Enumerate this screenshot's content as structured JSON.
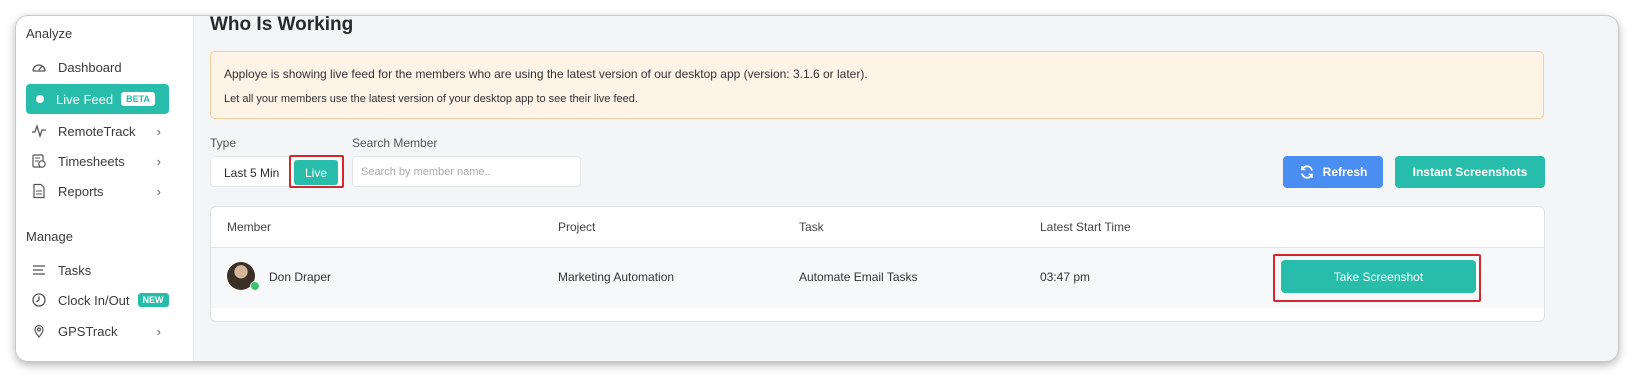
{
  "sidebar": {
    "sections": [
      {
        "label": "Analyze"
      },
      {
        "label": "Manage"
      }
    ],
    "items": [
      {
        "label": "Dashboard",
        "icon": "gauge-icon"
      },
      {
        "label": "Live Feed",
        "icon": "dot-icon",
        "badge": "BETA",
        "active": true
      },
      {
        "label": "RemoteTrack",
        "icon": "pulse-icon"
      },
      {
        "label": "Timesheets",
        "icon": "timesheet-icon"
      },
      {
        "label": "Reports",
        "icon": "report-icon"
      },
      {
        "label": "Tasks",
        "icon": "list-icon"
      },
      {
        "label": "Clock In/Out",
        "icon": "clock-icon",
        "badge": "NEW"
      },
      {
        "label": "GPSTrack",
        "icon": "map-pin-icon"
      }
    ]
  },
  "main": {
    "title": "Who Is Working",
    "notice": {
      "line1": "Apploye is showing live feed for the members who are using the latest version of our desktop app (version: 3.1.6 or later).",
      "line2": "Let all your members use the latest version of your desktop app to see their live feed."
    },
    "filters": {
      "type_label": "Type",
      "type_option_last": "Last 5 Min",
      "type_option_live": "Live",
      "search_label": "Search Member",
      "search_placeholder": "Search by member name..",
      "search_value": ""
    },
    "actions": {
      "refresh": "Refresh",
      "instant": "Instant Screenshots"
    },
    "table": {
      "columns": [
        "Member",
        "Project",
        "Task",
        "Latest Start Time"
      ],
      "rows": [
        {
          "member": "Don Draper",
          "project": "Marketing Automation",
          "task": "Automate Email Tasks",
          "start_time": "03:47 pm",
          "action": "Take Screenshot",
          "online": true
        }
      ]
    }
  },
  "colors": {
    "accent": "#27bdaa",
    "refresh": "#4b8ef3",
    "highlight": "#d4282f",
    "notice_bg": "#fdf3e7",
    "notice_border": "#f2cf9a"
  }
}
